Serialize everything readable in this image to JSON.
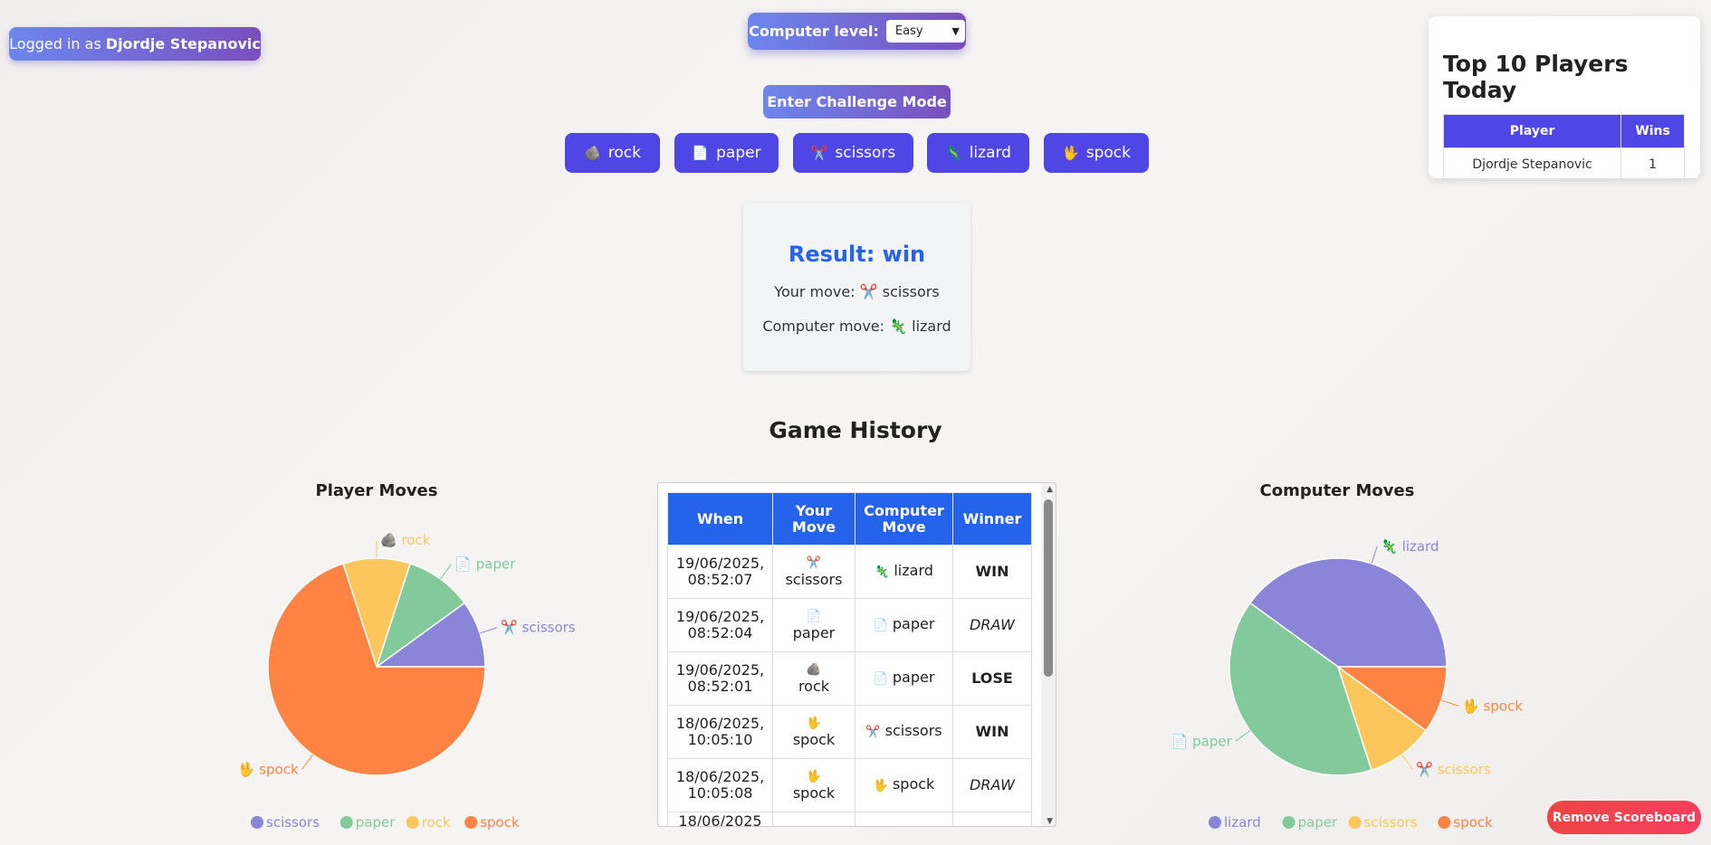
{
  "login": {
    "prefix": "Logged in as",
    "user": "Djordje Stepanovic"
  },
  "level": {
    "label": "Computer level:",
    "selected": "Easy"
  },
  "challenge_label": "Enter Challenge Mode",
  "moves": [
    {
      "icon": "🪨",
      "label": "rock"
    },
    {
      "icon": "📄",
      "label": "paper"
    },
    {
      "icon": "✂️",
      "label": "scissors"
    },
    {
      "icon": "🦎",
      "label": "lizard"
    },
    {
      "icon": "🖖",
      "label": "spock"
    }
  ],
  "result": {
    "title": "Result: win",
    "your_move_label": "Your move:",
    "your_move_icon": "✂️",
    "your_move": "scissors",
    "computer_move_label": "Computer move:",
    "computer_move_icon": "🦎",
    "computer_move": "lizard"
  },
  "top10": {
    "title": "Top 10 Players Today",
    "headers": [
      "Player",
      "Wins"
    ],
    "rows": [
      [
        "Djordje Stepanovic",
        "1"
      ]
    ]
  },
  "history": {
    "title": "Game History",
    "headers": [
      "When",
      "Your Move",
      "Computer Move",
      "Winner"
    ],
    "rows": [
      {
        "when": "19/06/2025, 08:52:07",
        "your_icon": "✂️",
        "your": "scissors",
        "comp_icon": "🦎",
        "comp": "lizard",
        "winner": "WIN"
      },
      {
        "when": "19/06/2025, 08:52:04",
        "your_icon": "📄",
        "your": "paper",
        "comp_icon": "📄",
        "comp": "paper",
        "winner": "DRAW"
      },
      {
        "when": "19/06/2025, 08:52:01",
        "your_icon": "🪨",
        "your": "rock",
        "comp_icon": "📄",
        "comp": "paper",
        "winner": "LOSE"
      },
      {
        "when": "18/06/2025, 10:05:10",
        "your_icon": "🖖",
        "your": "spock",
        "comp_icon": "✂️",
        "comp": "scissors",
        "winner": "WIN"
      },
      {
        "when": "18/06/2025, 10:05:08",
        "your_icon": "🖖",
        "your": "spock",
        "comp_icon": "🖖",
        "comp": "spock",
        "winner": "DRAW"
      },
      {
        "when": "18/06/2025",
        "your_icon": "🖖",
        "your": "",
        "comp_icon": "",
        "comp": "",
        "winner": ""
      }
    ]
  },
  "remove_label": "Remove Scoreboard",
  "chart_data": [
    {
      "type": "pie",
      "title": "Player Moves",
      "categories": [
        "scissors",
        "paper",
        "rock",
        "spock"
      ],
      "values": [
        1,
        1,
        1,
        7
      ],
      "icons": [
        "✂️",
        "📄",
        "🪨",
        "🖖"
      ],
      "colors": [
        "#8b85d9",
        "#82c99b",
        "#fdc65c",
        "#ff8443"
      ],
      "legend": "bottom"
    },
    {
      "type": "pie",
      "title": "Computer Moves",
      "categories": [
        "lizard",
        "paper",
        "scissors",
        "spock"
      ],
      "values": [
        4,
        4,
        1,
        1
      ],
      "icons": [
        "🦎",
        "📄",
        "✂️",
        "🖖"
      ],
      "colors": [
        "#8b85d9",
        "#82c99b",
        "#fdc65c",
        "#ff8443"
      ],
      "legend": "bottom"
    }
  ]
}
